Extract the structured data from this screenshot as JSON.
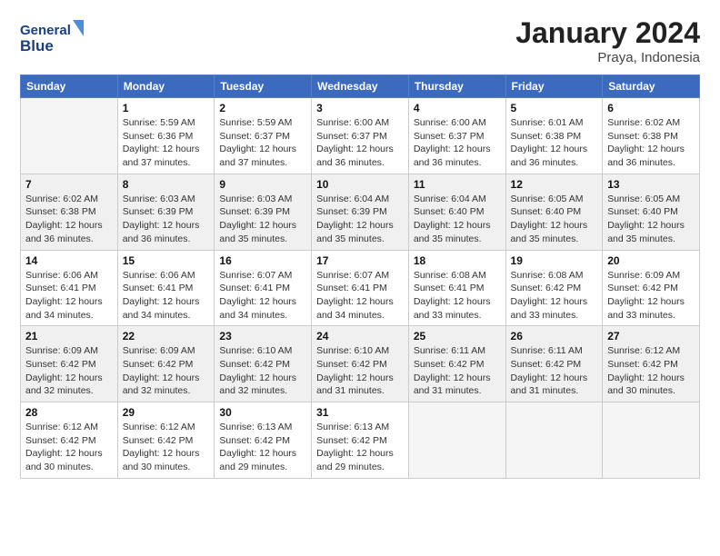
{
  "header": {
    "logo_line1": "General",
    "logo_line2": "Blue",
    "month_year": "January 2024",
    "location": "Praya, Indonesia"
  },
  "days_of_week": [
    "Sunday",
    "Monday",
    "Tuesday",
    "Wednesday",
    "Thursday",
    "Friday",
    "Saturday"
  ],
  "weeks": [
    [
      {
        "num": "",
        "info": ""
      },
      {
        "num": "1",
        "info": "Sunrise: 5:59 AM\nSunset: 6:36 PM\nDaylight: 12 hours\nand 37 minutes."
      },
      {
        "num": "2",
        "info": "Sunrise: 5:59 AM\nSunset: 6:37 PM\nDaylight: 12 hours\nand 37 minutes."
      },
      {
        "num": "3",
        "info": "Sunrise: 6:00 AM\nSunset: 6:37 PM\nDaylight: 12 hours\nand 36 minutes."
      },
      {
        "num": "4",
        "info": "Sunrise: 6:00 AM\nSunset: 6:37 PM\nDaylight: 12 hours\nand 36 minutes."
      },
      {
        "num": "5",
        "info": "Sunrise: 6:01 AM\nSunset: 6:38 PM\nDaylight: 12 hours\nand 36 minutes."
      },
      {
        "num": "6",
        "info": "Sunrise: 6:02 AM\nSunset: 6:38 PM\nDaylight: 12 hours\nand 36 minutes."
      }
    ],
    [
      {
        "num": "7",
        "info": "Sunrise: 6:02 AM\nSunset: 6:38 PM\nDaylight: 12 hours\nand 36 minutes."
      },
      {
        "num": "8",
        "info": "Sunrise: 6:03 AM\nSunset: 6:39 PM\nDaylight: 12 hours\nand 36 minutes."
      },
      {
        "num": "9",
        "info": "Sunrise: 6:03 AM\nSunset: 6:39 PM\nDaylight: 12 hours\nand 35 minutes."
      },
      {
        "num": "10",
        "info": "Sunrise: 6:04 AM\nSunset: 6:39 PM\nDaylight: 12 hours\nand 35 minutes."
      },
      {
        "num": "11",
        "info": "Sunrise: 6:04 AM\nSunset: 6:40 PM\nDaylight: 12 hours\nand 35 minutes."
      },
      {
        "num": "12",
        "info": "Sunrise: 6:05 AM\nSunset: 6:40 PM\nDaylight: 12 hours\nand 35 minutes."
      },
      {
        "num": "13",
        "info": "Sunrise: 6:05 AM\nSunset: 6:40 PM\nDaylight: 12 hours\nand 35 minutes."
      }
    ],
    [
      {
        "num": "14",
        "info": "Sunrise: 6:06 AM\nSunset: 6:41 PM\nDaylight: 12 hours\nand 34 minutes."
      },
      {
        "num": "15",
        "info": "Sunrise: 6:06 AM\nSunset: 6:41 PM\nDaylight: 12 hours\nand 34 minutes."
      },
      {
        "num": "16",
        "info": "Sunrise: 6:07 AM\nSunset: 6:41 PM\nDaylight: 12 hours\nand 34 minutes."
      },
      {
        "num": "17",
        "info": "Sunrise: 6:07 AM\nSunset: 6:41 PM\nDaylight: 12 hours\nand 34 minutes."
      },
      {
        "num": "18",
        "info": "Sunrise: 6:08 AM\nSunset: 6:41 PM\nDaylight: 12 hours\nand 33 minutes."
      },
      {
        "num": "19",
        "info": "Sunrise: 6:08 AM\nSunset: 6:42 PM\nDaylight: 12 hours\nand 33 minutes."
      },
      {
        "num": "20",
        "info": "Sunrise: 6:09 AM\nSunset: 6:42 PM\nDaylight: 12 hours\nand 33 minutes."
      }
    ],
    [
      {
        "num": "21",
        "info": "Sunrise: 6:09 AM\nSunset: 6:42 PM\nDaylight: 12 hours\nand 32 minutes."
      },
      {
        "num": "22",
        "info": "Sunrise: 6:09 AM\nSunset: 6:42 PM\nDaylight: 12 hours\nand 32 minutes."
      },
      {
        "num": "23",
        "info": "Sunrise: 6:10 AM\nSunset: 6:42 PM\nDaylight: 12 hours\nand 32 minutes."
      },
      {
        "num": "24",
        "info": "Sunrise: 6:10 AM\nSunset: 6:42 PM\nDaylight: 12 hours\nand 31 minutes."
      },
      {
        "num": "25",
        "info": "Sunrise: 6:11 AM\nSunset: 6:42 PM\nDaylight: 12 hours\nand 31 minutes."
      },
      {
        "num": "26",
        "info": "Sunrise: 6:11 AM\nSunset: 6:42 PM\nDaylight: 12 hours\nand 31 minutes."
      },
      {
        "num": "27",
        "info": "Sunrise: 6:12 AM\nSunset: 6:42 PM\nDaylight: 12 hours\nand 30 minutes."
      }
    ],
    [
      {
        "num": "28",
        "info": "Sunrise: 6:12 AM\nSunset: 6:42 PM\nDaylight: 12 hours\nand 30 minutes."
      },
      {
        "num": "29",
        "info": "Sunrise: 6:12 AM\nSunset: 6:42 PM\nDaylight: 12 hours\nand 30 minutes."
      },
      {
        "num": "30",
        "info": "Sunrise: 6:13 AM\nSunset: 6:42 PM\nDaylight: 12 hours\nand 29 minutes."
      },
      {
        "num": "31",
        "info": "Sunrise: 6:13 AM\nSunset: 6:42 PM\nDaylight: 12 hours\nand 29 minutes."
      },
      {
        "num": "",
        "info": ""
      },
      {
        "num": "",
        "info": ""
      },
      {
        "num": "",
        "info": ""
      }
    ]
  ]
}
